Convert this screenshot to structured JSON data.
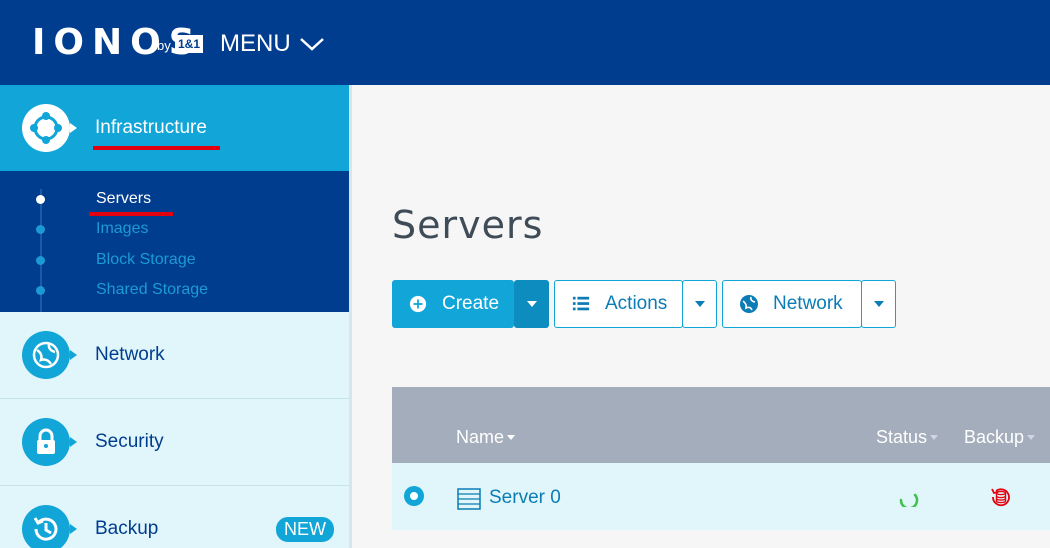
{
  "header": {
    "logo": "IONOS",
    "logo_by": "by",
    "logo_brand": "1&1",
    "menu_label": "MENU"
  },
  "sidebar": {
    "infrastructure": {
      "label": "Infrastructure",
      "icon": "infrastructure-icon"
    },
    "subitems": [
      {
        "label": "Servers",
        "active": true
      },
      {
        "label": "Images",
        "active": false
      },
      {
        "label": "Block Storage",
        "active": false
      },
      {
        "label": "Shared Storage",
        "active": false
      }
    ],
    "items": [
      {
        "label": "Network",
        "icon": "globe-icon"
      },
      {
        "label": "Security",
        "icon": "lock-icon"
      },
      {
        "label": "Backup",
        "icon": "history-icon",
        "badge": "NEW"
      }
    ]
  },
  "main": {
    "title": "Servers",
    "toolbar": {
      "create_label": "Create",
      "actions_label": "Actions",
      "network_label": "Network"
    },
    "table": {
      "columns": [
        "Name",
        "Status",
        "Backup"
      ],
      "rows": [
        {
          "name": "Server 0",
          "status": "loading",
          "backup": "backup-disabled"
        }
      ]
    }
  },
  "colors": {
    "header_bg": "#003d8f",
    "accent": "#11a5d8",
    "highlight_underline": "#e3000f",
    "status_ok": "#3ac24a",
    "backup_error": "#e3000f"
  }
}
